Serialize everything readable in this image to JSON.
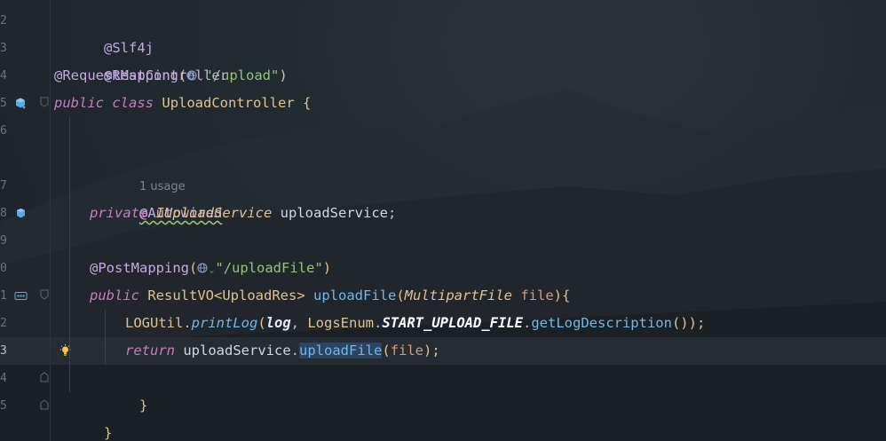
{
  "editor": {
    "line_numbers": [
      "2",
      "3",
      "4",
      "5",
      "6",
      "7",
      "8",
      "9",
      "0",
      "1",
      "2",
      "3",
      "4",
      "5"
    ],
    "current_line_number": "3",
    "usage_hint": "1 usage",
    "lines": {
      "l2": {
        "annotation": "@Slf4j"
      },
      "l3": {
        "annotation": "@RestController"
      },
      "l4": {
        "annotation": "@RequestMapping",
        "open": "(",
        "path": "\"/upload\"",
        "close": ")"
      },
      "l5": {
        "kw1": "public",
        "kw2": "class",
        "name": "UploadController",
        "brace": "{"
      },
      "l7": {
        "annotation": "@Autowired"
      },
      "l8": {
        "kw": "private",
        "type": "IUploadService",
        "field": "uploadService",
        "semi": ";"
      },
      "l10": {
        "annotation": "@PostMapping",
        "open": "(",
        "path": "\"/uploadFile\"",
        "close": ")"
      },
      "l11": {
        "kw": "public",
        "type": "ResultVO<UploadRes>",
        "method": "uploadFile",
        "open": "(",
        "ptype": "MultipartFile",
        "pname": "file",
        "close": "){"
      },
      "l12": {
        "cls": "LOGUtil",
        "dot1": ".",
        "method": "printLog",
        "open": "(",
        "arg1": "log",
        "comma": ", ",
        "enum": "LogsEnum",
        "dot2": ".",
        "const": "START_UPLOAD_FILE",
        "dot3": ".",
        "getter": "getLogDescription",
        "close": "());"
      },
      "l13": {
        "kw": "return",
        "obj": "uploadService",
        "dot": ".",
        "method": "uploadFile",
        "open": "(",
        "arg": "file",
        "close": ");"
      },
      "l14": {
        "brace": "}"
      },
      "l15": {
        "brace": "}"
      }
    }
  },
  "colors": {
    "background": "#1e2329",
    "keyword": "#c77dbb",
    "annotation": "#bbb529",
    "string": "#95c37a",
    "method": "#70b8e8",
    "type": "#e0c38c"
  },
  "icons": {
    "l5": "bean-class-icon",
    "l8": "bean-field-icon",
    "l11": "api-endpoint-icon",
    "l13": "lightbulb-icon",
    "url": "globe-icon"
  }
}
